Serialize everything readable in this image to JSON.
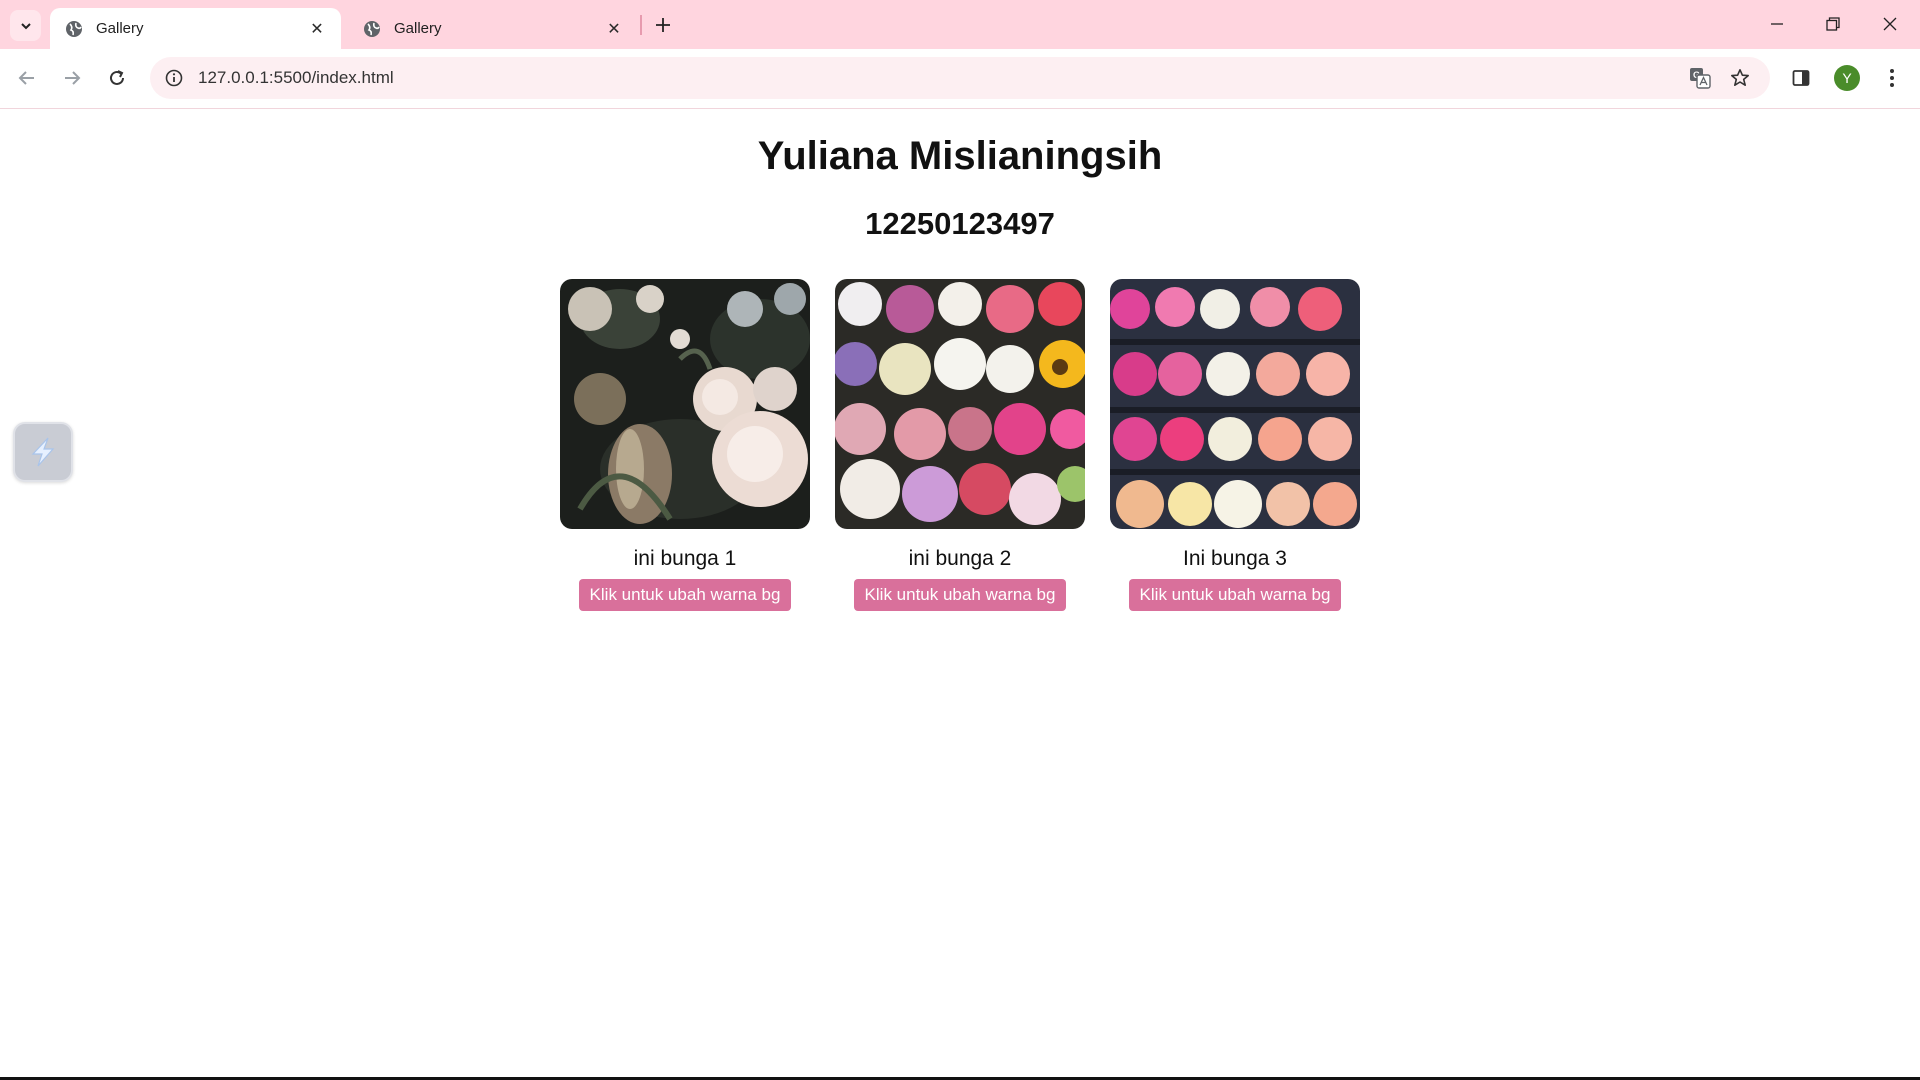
{
  "browser": {
    "tabs": [
      {
        "title": "Gallery",
        "active": true
      },
      {
        "title": "Gallery",
        "active": false
      }
    ],
    "url": "127.0.0.1:5500/index.html",
    "profile_initial": "Y",
    "accent_color": "#ffd5df"
  },
  "page": {
    "title": "Yuliana Mislianingsih",
    "subtitle": "12250123497",
    "cards": [
      {
        "caption": "ini bunga 1",
        "button_label": "Klik untuk ubah warna bg"
      },
      {
        "caption": "ini bunga 2",
        "button_label": "Klik untuk ubah warna bg"
      },
      {
        "caption": "Ini bunga 3",
        "button_label": "Klik untuk ubah warna bg"
      }
    ],
    "button_color": "#d9709b"
  }
}
